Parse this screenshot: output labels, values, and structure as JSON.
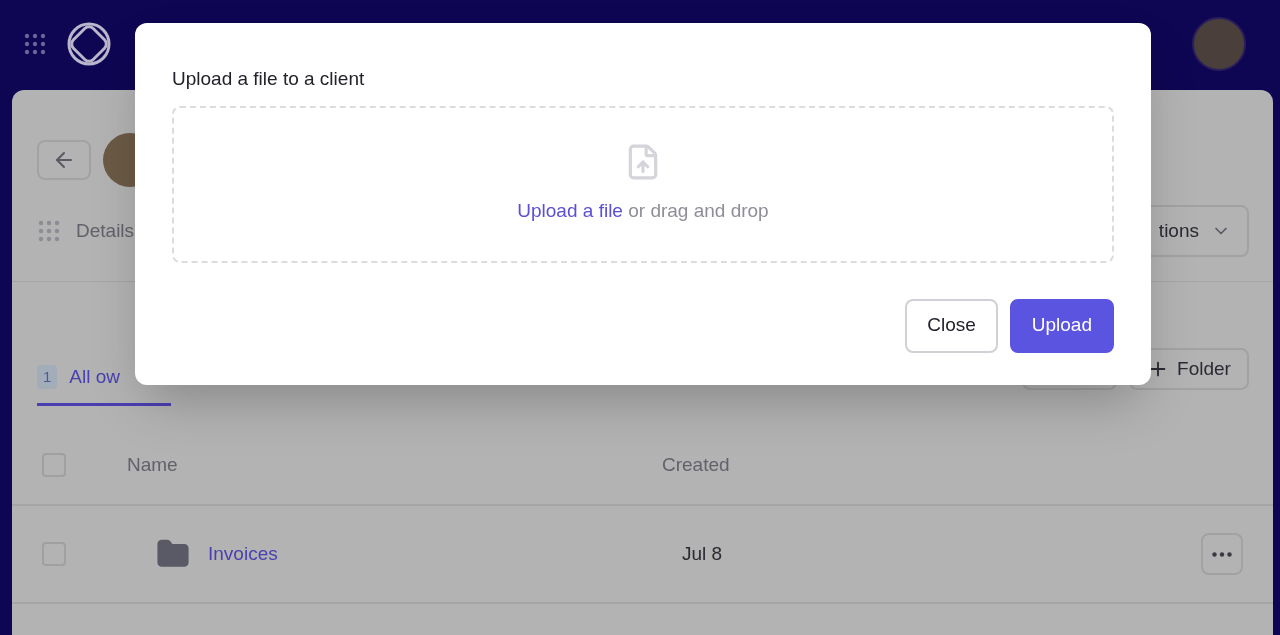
{
  "page": {
    "details_label": "Details",
    "actions_button": "tions",
    "tabs": [
      {
        "label": "All ow",
        "count": "1",
        "selected": true
      }
    ],
    "folder_button": "Folder",
    "table": {
      "header_checked": false,
      "columns": [
        "Name",
        "Created"
      ],
      "rows": [
        {
          "name": "Invoices",
          "created": "Jul 8",
          "checked": false
        }
      ]
    }
  },
  "modal": {
    "title": "Upload a file to a client",
    "dropzone": {
      "link": "Upload a file",
      "text": "or drag and drop"
    },
    "buttons": [
      {
        "label": "Close",
        "kind": "secondary"
      },
      {
        "label": "Upload",
        "kind": "primary"
      }
    ]
  }
}
